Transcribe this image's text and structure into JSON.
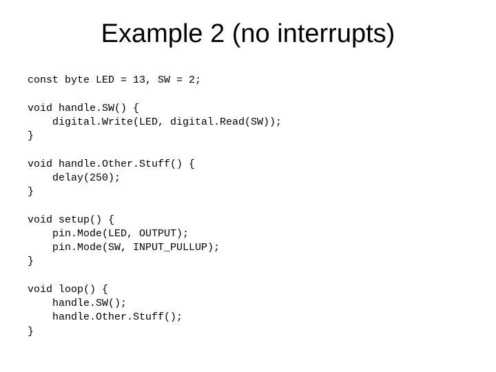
{
  "title": "Example 2 (no interrupts)",
  "code": {
    "line1": "const byte LED = 13, SW = 2;",
    "block1_l1": "void handle.SW() {",
    "block1_l2": "    digital.Write(LED, digital.Read(SW));",
    "block1_l3": "}",
    "block2_l1": "void handle.Other.Stuff() {",
    "block2_l2": "    delay(250);",
    "block2_l3": "}",
    "block3_l1": "void setup() {",
    "block3_l2": "    pin.Mode(LED, OUTPUT);",
    "block3_l3": "    pin.Mode(SW, INPUT_PULLUP);",
    "block3_l4": "}",
    "block4_l1": "void loop() {",
    "block4_l2": "    handle.SW();",
    "block4_l3": "    handle.Other.Stuff();",
    "block4_l4": "}"
  }
}
